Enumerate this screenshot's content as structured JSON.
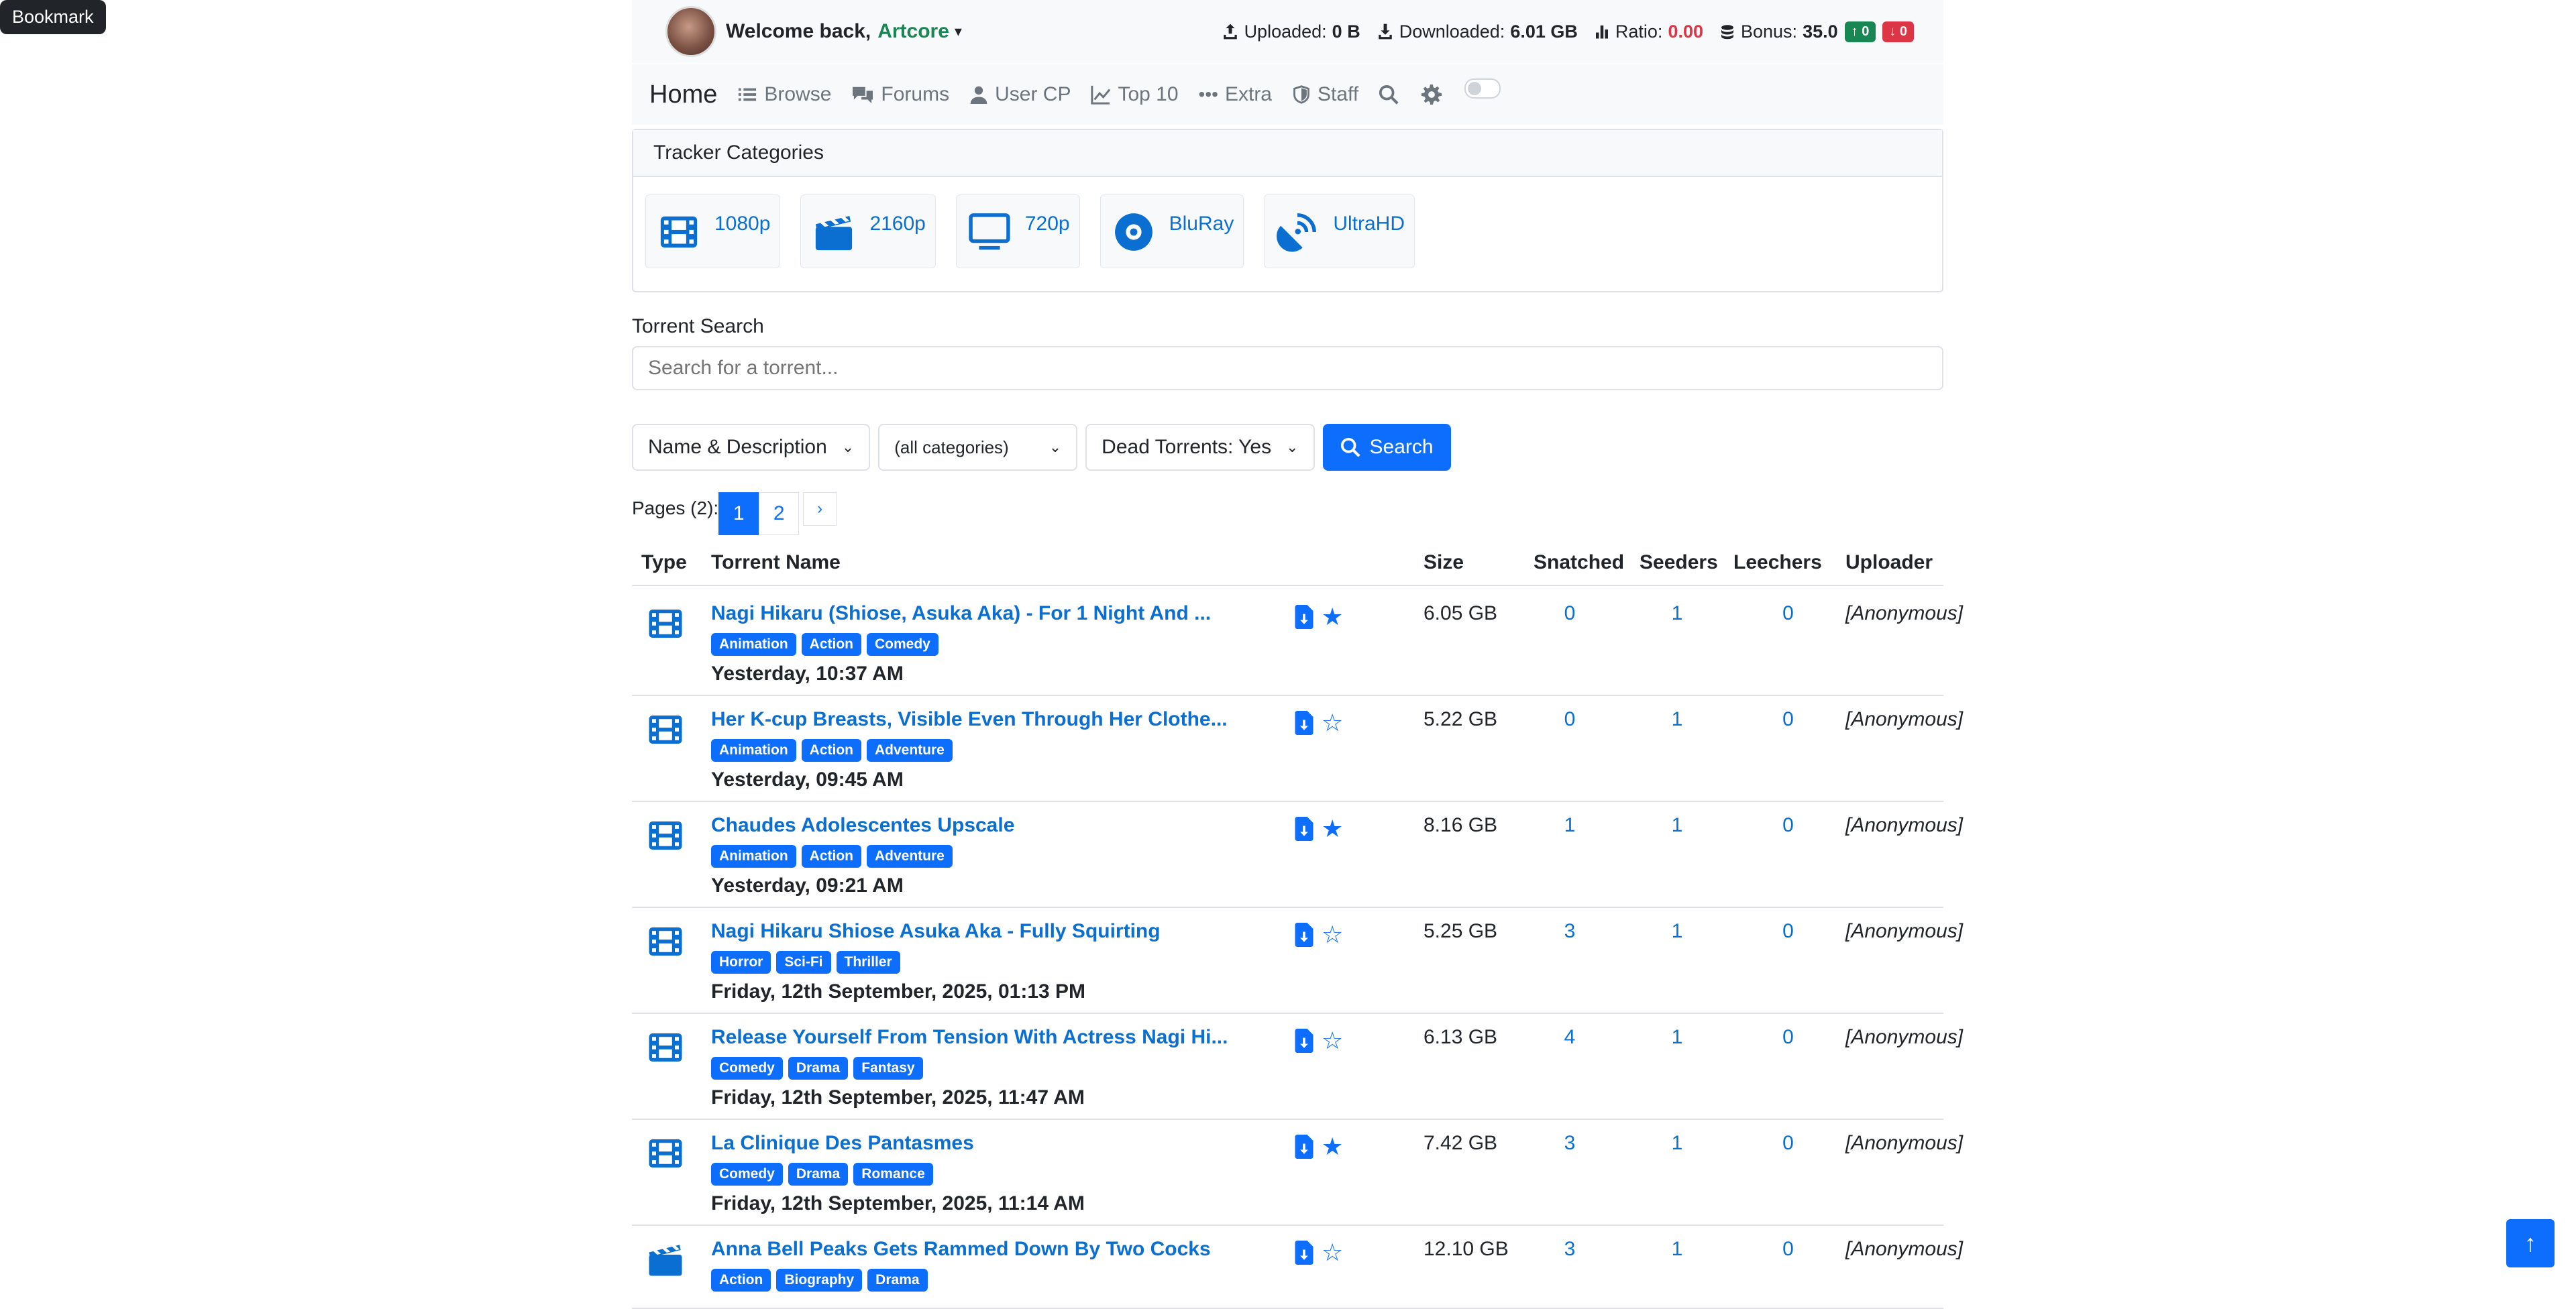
{
  "tooltip": "Bookmark",
  "userbar": {
    "welcome": "Welcome back,",
    "username": "Artcore",
    "uploaded_label": "Uploaded:",
    "uploaded_value": "0 B",
    "downloaded_label": "Downloaded:",
    "downloaded_value": "6.01 GB",
    "ratio_label": "Ratio:",
    "ratio_value": "0.00",
    "bonus_label": "Bonus:",
    "bonus_value": "35.0",
    "up_count": "0",
    "down_count": "0"
  },
  "nav": {
    "home": "Home",
    "items": [
      {
        "label": "Browse",
        "icon": "list-icon"
      },
      {
        "label": "Forums",
        "icon": "comments-icon"
      },
      {
        "label": "User CP",
        "icon": "user-icon"
      },
      {
        "label": "Top 10",
        "icon": "chart-line-icon"
      },
      {
        "label": "Extra",
        "icon": "ellipsis-icon"
      },
      {
        "label": "Staff",
        "icon": "shield-icon"
      }
    ]
  },
  "categories": {
    "title": "Tracker Categories",
    "items": [
      {
        "label": "1080p",
        "icon": "film-icon"
      },
      {
        "label": "2160p",
        "icon": "clapperboard-icon"
      },
      {
        "label": "720p",
        "icon": "tv-icon"
      },
      {
        "label": "BluRay",
        "icon": "disc-icon"
      },
      {
        "label": "UltraHD",
        "icon": "satellite-dish-icon"
      }
    ]
  },
  "search": {
    "label": "Torrent Search",
    "placeholder": "Search for a torrent...",
    "field_select": "Name & Description",
    "category_select": "(all categories)",
    "dead_select": "Dead Torrents: Yes",
    "button": "Search"
  },
  "pager": {
    "label": "Pages (2):",
    "pages": [
      "1",
      "2"
    ],
    "current": "1",
    "next": "›"
  },
  "table": {
    "headers": {
      "type": "Type",
      "name": "Torrent Name",
      "size": "Size",
      "snatched": "Snatched",
      "seeders": "Seeders",
      "leechers": "Leechers",
      "uploader": "Uploader"
    },
    "rows": [
      {
        "name": "Nagi Hikaru (Shiose, Asuka Aka) - For 1 Night And ...",
        "tags": [
          "Animation",
          "Action",
          "Comedy"
        ],
        "date": "Yesterday, 10:37 AM",
        "size": "6.05 GB",
        "snatched": "0",
        "seeders": "1",
        "leechers": "0",
        "uploader": "[Anonymous]",
        "bookmarked": true,
        "type_icon": "film-icon"
      },
      {
        "name": "Her K-cup Breasts, Visible Even Through Her Clothe...",
        "tags": [
          "Animation",
          "Action",
          "Adventure"
        ],
        "date": "Yesterday, 09:45 AM",
        "size": "5.22 GB",
        "snatched": "0",
        "seeders": "1",
        "leechers": "0",
        "uploader": "[Anonymous]",
        "bookmarked": false,
        "type_icon": "film-icon"
      },
      {
        "name": "Chaudes Adolescentes Upscale",
        "tags": [
          "Animation",
          "Action",
          "Adventure"
        ],
        "date": "Yesterday, 09:21 AM",
        "size": "8.16 GB",
        "snatched": "1",
        "seeders": "1",
        "leechers": "0",
        "uploader": "[Anonymous]",
        "bookmarked": true,
        "type_icon": "film-icon"
      },
      {
        "name": "Nagi Hikaru Shiose Asuka Aka - Fully Squirting",
        "tags": [
          "Horror",
          "Sci-Fi",
          "Thriller"
        ],
        "date": "Friday, 12th September, 2025, 01:13 PM",
        "size": "5.25 GB",
        "snatched": "3",
        "seeders": "1",
        "leechers": "0",
        "uploader": "[Anonymous]",
        "bookmarked": false,
        "type_icon": "film-icon"
      },
      {
        "name": "Release Yourself From Tension With Actress Nagi Hi...",
        "tags": [
          "Comedy",
          "Drama",
          "Fantasy"
        ],
        "date": "Friday, 12th September, 2025, 11:47 AM",
        "size": "6.13 GB",
        "snatched": "4",
        "seeders": "1",
        "leechers": "0",
        "uploader": "[Anonymous]",
        "bookmarked": false,
        "type_icon": "film-icon"
      },
      {
        "name": "La Clinique Des Pantasmes",
        "tags": [
          "Comedy",
          "Drama",
          "Romance"
        ],
        "date": "Friday, 12th September, 2025, 11:14 AM",
        "size": "7.42 GB",
        "snatched": "3",
        "seeders": "1",
        "leechers": "0",
        "uploader": "[Anonymous]",
        "bookmarked": true,
        "type_icon": "film-icon"
      },
      {
        "name": "Anna Bell Peaks Gets Rammed Down By Two Cocks",
        "tags": [
          "Action",
          "Biography",
          "Drama"
        ],
        "date": "",
        "size": "12.10 GB",
        "snatched": "3",
        "seeders": "1",
        "leechers": "0",
        "uploader": "[Anonymous]",
        "bookmarked": false,
        "type_icon": "clapperboard-icon"
      }
    ]
  },
  "colors": {
    "primary": "#0d6efd",
    "link": "#0a6fd0",
    "success": "#198754",
    "danger": "#dc3545",
    "navbar_bg": "#f8f9fa"
  }
}
